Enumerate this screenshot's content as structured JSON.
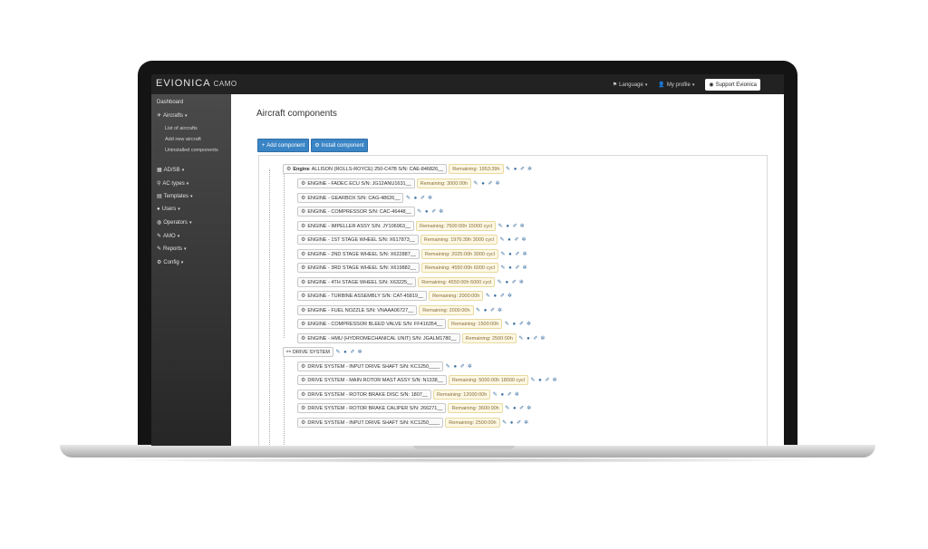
{
  "app": {
    "brand": "EVIONICA",
    "brand_sub": "CAMO"
  },
  "navbar": {
    "language": "Language",
    "my_profile": "My profile",
    "support": "Support Evionica"
  },
  "sidebar": {
    "dashboard": "Dashboard",
    "aircrafts": "Aircrafts",
    "aircrafts_sub": [
      "List of aircrafts",
      "Add new aircraft",
      "Uninstalled components"
    ],
    "items": [
      "AD/SB",
      "AC types",
      "Templates",
      "Users",
      "Operators",
      "AMO",
      "Reports",
      "Config"
    ]
  },
  "main": {
    "title": "Aircraft components",
    "add_button": "Add component",
    "install_button": "Install component"
  },
  "tree": {
    "engine_root": {
      "label_bold": "Engine",
      "label": "ALLISON (ROLLS-ROYCE) 250-C47B S/N: CAE-846826__",
      "remaining": "Remaining: 1953:39h"
    },
    "engine_children": [
      {
        "label": "ENGINE - FADEC ECU S/N: JG12ANU1631__",
        "remaining": "Remaining: 3000:00h"
      },
      {
        "label": "ENGINE - GEARBOX S/N: CAG-48626__",
        "remaining": ""
      },
      {
        "label": "ENGINE - COMPRESSOR S/N: CAC-46448__",
        "remaining": ""
      },
      {
        "label": "ENGINE - IMPELLER ASSY S/N: JY106963__",
        "remaining": "Remaining: 7500:00h    15000 cycl"
      },
      {
        "label": "ENGINE - 1ST STAGE WHEEL S/N: X617873__",
        "remaining": "Remaining: 1976:39h    3000 cycl"
      },
      {
        "label": "ENGINE - 2ND STAGE WHEEL S/N: X622887__",
        "remaining": "Remaining: 2025:00h    3000 cycl"
      },
      {
        "label": "ENGINE - 3RD STAGE WHEEL S/N: X619882__",
        "remaining": "Remaining: 4550:00h    6000 cycl"
      },
      {
        "label": "ENGINE - 4TH STAGE WHEEL S/N: X63225__",
        "remaining": "Remaining: 4550:00h    6000 cycl"
      },
      {
        "label": "ENGINE - TURBINE ASSEMBLY S/N: CAT-45819__",
        "remaining": "Remaining: 2000:00h"
      },
      {
        "label": "ENGINE - FUEL NOZZLE S/N: VNAAA06727__",
        "remaining": "Remaining: 2000:00h"
      },
      {
        "label": "ENGINE - COMPRESSOR BLEED VALVE S/N: FF416354__",
        "remaining": "Remaining: 1500:00h"
      },
      {
        "label": "ENGINE - HMU (HYDROMECHANICAL UNIT) S/N: JGALM1780__",
        "remaining": "Remaining: 2500:00h"
      }
    ],
    "drive_root": {
      "label": "DRIVE SYSTEM"
    },
    "drive_children": [
      {
        "label": "DRIVE SYSTEM - INPUT DRIVE SHAFT S/N: KC1250____",
        "remaining": ""
      },
      {
        "label": "DRIVE SYSTEM - MAIN ROTOR MAST ASSY S/N: N1338__",
        "remaining": "Remaining: 5000:00h    18000 cycl"
      },
      {
        "label": "DRIVE SYSTEM - ROTOR BRAKE DISC S/N: 1807__",
        "remaining": "Remaining: 12000:00h"
      },
      {
        "label": "DRIVE SYSTEM - ROTOR BRAKE CALIPER S/N: 266271__",
        "remaining": "Remaining: 3600:00h"
      },
      {
        "label": "DRIVE SYSTEM - INPUT DRIVE SHAFT S/N: KC1250____",
        "remaining": "Remaining: 2500:00h"
      }
    ]
  }
}
